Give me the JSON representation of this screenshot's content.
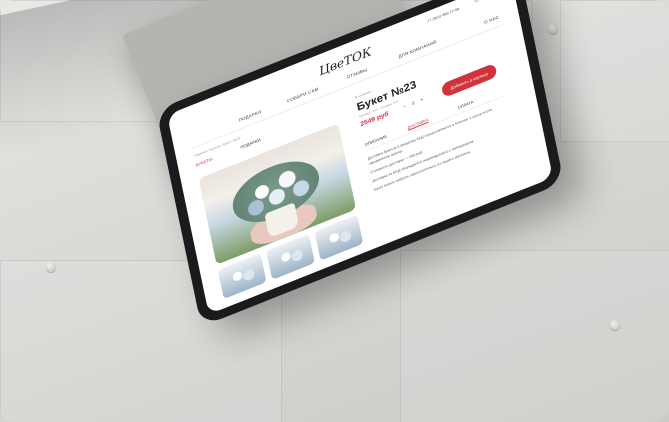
{
  "header": {
    "phone": "+7 (921) 995-77-99",
    "logo": "ЦвеТОК",
    "nav": [
      "ПОДАРКИ",
      "СОБЕРИ САМ",
      "ОТЗЫВЫ",
      "ДЛЯ КОМПАНИЙ",
      "О НАС"
    ]
  },
  "breadcrumb": "Главная / Букеты / Букет №23",
  "filters": {
    "catalog": "БУКЕТЫ",
    "gifts": "ПОДАРКИ"
  },
  "product": {
    "subtitle": "В наличии",
    "title": "Букет №23",
    "meta": "Артикул: 323  ·  Отзывы (14)",
    "price": "2549 руб",
    "qty": "1",
    "minus": "−",
    "plus": "+",
    "add_to_cart": "Добавить в корзину",
    "tabs": [
      "ОПИСАНИЕ",
      "ДОСТАВКА",
      "ОПЛАТА"
    ],
    "desc": [
      "Доставка букетов в пределах КАД осуществляется в течение 2 часов после оформления заказа.",
      "Стоимость доставки — 300 руб.",
      "Доставка за КАД обсуждается индивидуально с менеджером.",
      "Букет можно забрать самостоятельно из нашего магазина."
    ]
  },
  "icons": {
    "user": "user-icon",
    "cart": "cart-icon"
  }
}
